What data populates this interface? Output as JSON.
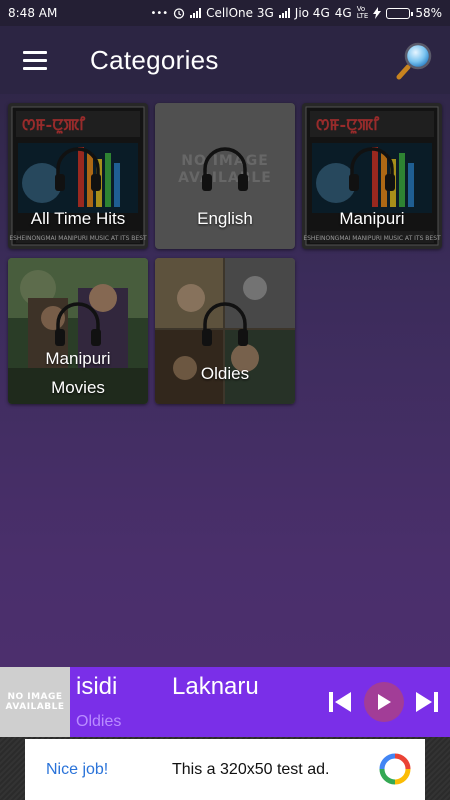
{
  "status_bar": {
    "time": "8:48 AM",
    "carrier1": "CellOne 3G",
    "carrier2": "Jio 4G",
    "network2": "4G",
    "volte_top": "Vo",
    "volte_bottom": "LTE",
    "battery": "58%",
    "battery_level": 0.58
  },
  "app_bar": {
    "title": "Categories",
    "menu_icon": "hamburger-menu-icon",
    "search_icon": "magnifier-search-icon"
  },
  "categories": [
    {
      "label": "All Time Hits",
      "art": "album-art"
    },
    {
      "label": "English",
      "art": "no-image"
    },
    {
      "label": "Manipuri",
      "art": "album-art"
    },
    {
      "label": "Manipuri Movies",
      "art": "movie-photo"
    },
    {
      "label": "Oldies",
      "art": "collage-photo"
    }
  ],
  "no_image_text": "NO IMAGE AVAILABLE",
  "player": {
    "thumb_text": "NO IMAGE AVAILABLE",
    "title": "isidi Laknaru",
    "subtitle": "Oldies",
    "controls": [
      "previous-icon",
      "play-icon",
      "next-icon"
    ]
  },
  "ad": {
    "nice": "Nice job!",
    "text": "This a 320x50 test ad."
  },
  "colors": {
    "player_bg": "#7a2fe8",
    "play_button": "#a23d97",
    "ad_link": "#2a73d9",
    "battery": "#35d23a"
  }
}
